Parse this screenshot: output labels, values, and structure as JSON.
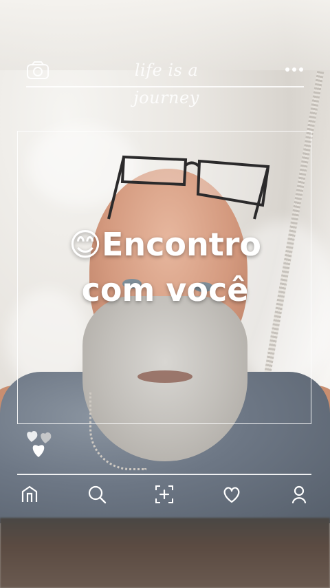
{
  "overlay": {
    "title": "life is a journey",
    "headline_line1": "😊Encontro",
    "headline_line2": "com você"
  },
  "icons": {
    "top_left": "camera-icon",
    "top_right": "more-icon",
    "hearts": "hearts-icon"
  },
  "nav": [
    {
      "name": "home-icon"
    },
    {
      "name": "search-icon"
    },
    {
      "name": "add-post-icon"
    },
    {
      "name": "heart-icon"
    },
    {
      "name": "profile-icon"
    }
  ],
  "colors": {
    "overlay_line": "#ffffff",
    "headline_text": "#ffffff"
  }
}
